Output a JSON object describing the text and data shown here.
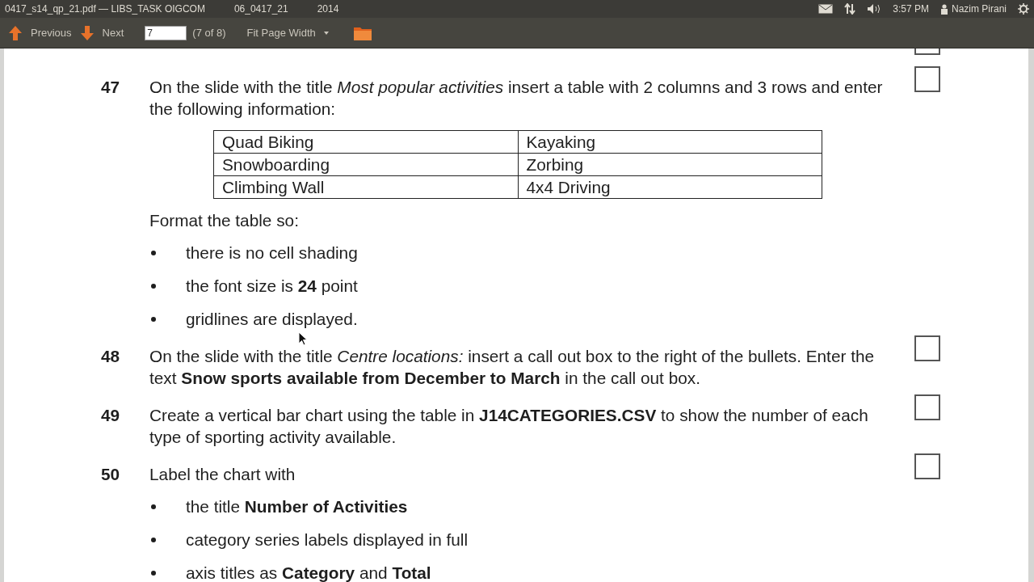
{
  "panel": {
    "title_segments": [
      "0417_s14_qp_21.pdf — LIBS_TASK OIGCOM",
      "06_0417_21",
      "2014"
    ],
    "clock": "3:57 PM",
    "user": "Nazim Pirani"
  },
  "toolbar": {
    "previous": "Previous",
    "next": "Next",
    "page_field": {
      "value": "7"
    },
    "page_count": "(7 of 8)",
    "zoom": "Fit Page Width"
  },
  "previous_question": {
    "checked": false
  },
  "questions": [
    {
      "number": "47",
      "checked": false,
      "blocks": [
        {
          "kind": "text",
          "text": "On the slide with the title *Most popular activities* insert a table with 2 columns and 3 rows and enter the following information:"
        },
        {
          "kind": "table",
          "rows": [
            [
              "Quad Biking",
              "Kayaking"
            ],
            [
              "Snowboarding",
              "Zorbing"
            ],
            [
              "Climbing Wall",
              "4x4 Driving"
            ]
          ]
        },
        {
          "kind": "text",
          "text": "Format the table so:"
        },
        {
          "kind": "bullets",
          "items": [
            "there is no cell shading",
            "the font size is **24** point",
            "gridlines are displayed."
          ]
        }
      ]
    },
    {
      "number": "48",
      "checked": false,
      "blocks": [
        {
          "kind": "text",
          "text": "On the slide with the title *Centre locations:* insert a call out box to the right of the bullets. Enter the text **Snow sports available from December to March** in the call out box."
        }
      ]
    },
    {
      "number": "49",
      "checked": false,
      "blocks": [
        {
          "kind": "text",
          "text": "Create a vertical bar chart using the table in **J14CATEGORIES.CSV** to show the number of each type of sporting activity available."
        }
      ]
    },
    {
      "number": "50",
      "checked": false,
      "blocks": [
        {
          "kind": "text",
          "text": "Label the chart with"
        },
        {
          "kind": "bullets",
          "items": [
            "the title **Number of Activities**",
            "category series labels displayed in full",
            "axis titles as **Category** and **Total**"
          ]
        }
      ]
    }
  ]
}
